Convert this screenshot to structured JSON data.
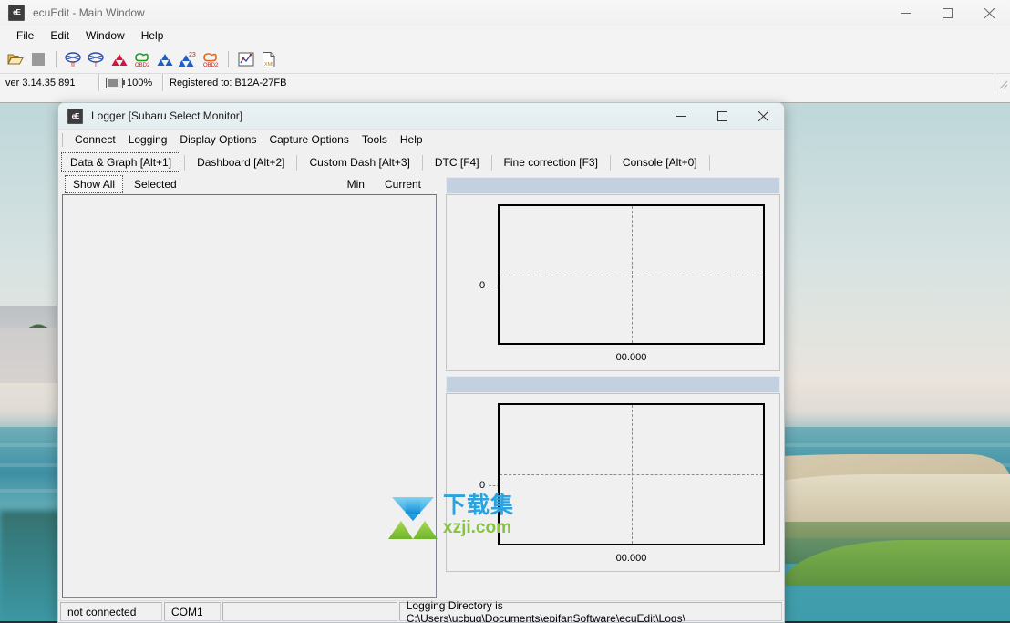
{
  "main_window": {
    "title": "ecuEdit - Main Window",
    "app_icon": "ecuedit-app-icon",
    "menus": [
      "File",
      "Edit",
      "Window",
      "Help"
    ],
    "window_controls": {
      "minimize": "minimize-icon",
      "maximize": "maximize-icon",
      "close": "close-icon"
    },
    "toolbar": [
      {
        "name": "open-file-icon",
        "title": "Open"
      },
      {
        "name": "stop-icon",
        "title": "Stop"
      },
      {
        "name": "logger-ii-icon",
        "title": "Logger II"
      },
      {
        "name": "logger-i-icon",
        "title": "Logger I"
      },
      {
        "name": "mitsubishi-icon",
        "title": "Mitsubishi"
      },
      {
        "name": "obd2-green-icon",
        "title": "OBD2"
      },
      {
        "name": "subaru-blue-icon",
        "title": "Subaru"
      },
      {
        "name": "subaru-23-icon",
        "title": "Subaru 23"
      },
      {
        "name": "obd2-orange-icon",
        "title": "OBD2"
      },
      {
        "name": "graph-icon",
        "title": "Graph"
      },
      {
        "name": "xml-file-icon",
        "title": "XML"
      }
    ],
    "status_bar": {
      "version": "ver 3.14.35.891",
      "battery_icon": "battery-icon",
      "battery_percent": "100%",
      "registration": "Registered to: B12A-27FB"
    }
  },
  "logger_window": {
    "title": "Logger [Subaru Select Monitor]",
    "app_icon": "ecuedit-app-icon",
    "window_controls": {
      "minimize": "minimize-icon",
      "maximize": "maximize-icon",
      "close": "close-icon"
    },
    "menus": [
      "Connect",
      "Logging",
      "Display Options",
      "Capture Options",
      "Tools",
      "Help"
    ],
    "tabs": [
      {
        "label": "Data & Graph [Alt+1]",
        "active": true
      },
      {
        "label": "Dashboard [Alt+2]",
        "active": false
      },
      {
        "label": "Custom Dash [Alt+3]",
        "active": false
      },
      {
        "label": "DTC [F4]",
        "active": false
      },
      {
        "label": "Fine correction [F3]",
        "active": false
      },
      {
        "label": "Console [Alt+0]",
        "active": false
      }
    ],
    "left_pane": {
      "show_all_button": "Show All",
      "selected_label": "Selected",
      "columns": [
        "Min",
        "Current"
      ],
      "rows": []
    },
    "graphs": [
      {
        "y_label": "0",
        "x_label": "00.000"
      },
      {
        "y_label": "0",
        "x_label": "00.000"
      }
    ],
    "status_bar": {
      "connection": "not connected",
      "port": "COM1",
      "spacer": "",
      "logging_directory": "Logging Directory is C:\\Users\\ucbug\\Documents\\epifanSoftware\\ecuEdit\\Logs\\"
    }
  },
  "watermark": {
    "logo_name": "xzji-download-logo",
    "chinese_text": "下载集",
    "site": "xzji.com",
    "blue": "#2aa3e0",
    "green": "#86c440"
  }
}
